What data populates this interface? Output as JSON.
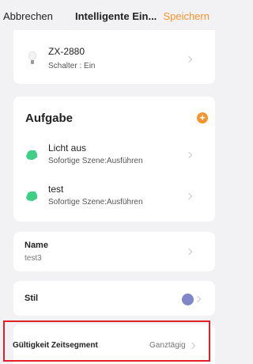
{
  "header": {
    "cancel_label": "Abbrechen",
    "title": "Intelligente Ein...",
    "save_label": "Speichern",
    "accent_color": "#f5932d"
  },
  "device": {
    "name": "ZX-2880",
    "status": "Schalter : Ein",
    "icon": "lightbulb-icon"
  },
  "tasks": {
    "title": "Aufgabe",
    "items": [
      {
        "name": "Licht aus",
        "subtitle": "Sofortige Szene:Ausführen",
        "icon": "tag-icon"
      },
      {
        "name": "test",
        "subtitle": "Sofortige Szene:Ausführen",
        "icon": "tag-icon"
      }
    ]
  },
  "name_field": {
    "label": "Name",
    "value": "test3"
  },
  "style_field": {
    "label": "Stil",
    "color": "#7f87c9"
  },
  "validity": {
    "label": "Gültigkeit Zeitsegment",
    "value": "Ganztägig"
  }
}
